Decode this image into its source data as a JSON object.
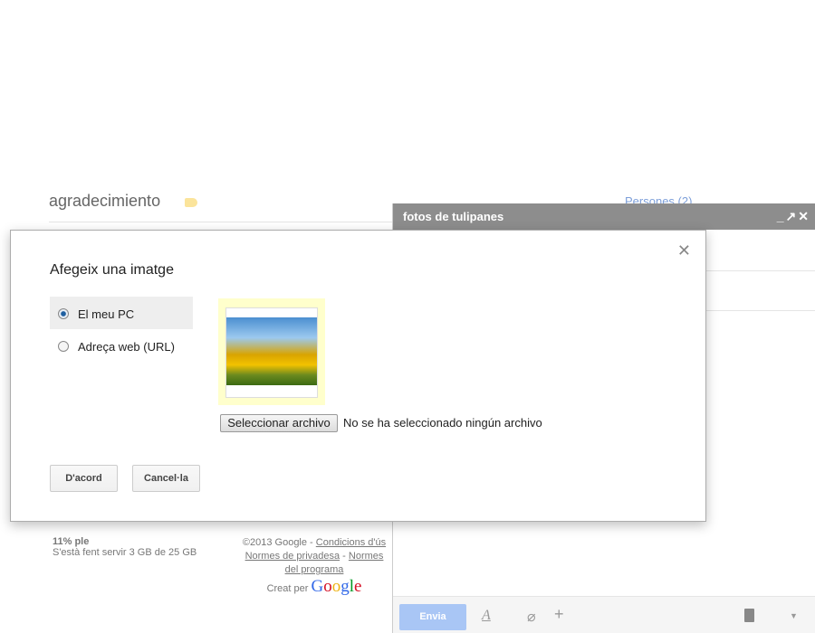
{
  "background": {
    "thread_title": "agradecimiento",
    "people_link": "Persones (2)",
    "storage": {
      "percent": "11% ple",
      "usage": "S'està fent servir 3 GB de 25 GB"
    },
    "legal": {
      "copyright": "©2013 Google - ",
      "terms": "Condicions d'ús",
      "privacy": "Normes de privadesa",
      "sep": " - ",
      "program": "Normes del programa",
      "created_by": "Creat per ",
      "logo": "Google"
    }
  },
  "compose": {
    "title": "fotos de tulipanes",
    "controls": "_↗✕",
    "send_label": "Envia"
  },
  "dialog": {
    "title": "Afegeix una imatge",
    "close": "✕",
    "options": [
      {
        "label": "El meu PC",
        "selected": true
      },
      {
        "label": "Adreça web (URL)",
        "selected": false
      }
    ],
    "file_button": "Seleccionar archivo",
    "file_status": "No se ha seleccionado ningún archivo",
    "ok_label": "D'acord",
    "cancel_label": "Cancel·la"
  }
}
